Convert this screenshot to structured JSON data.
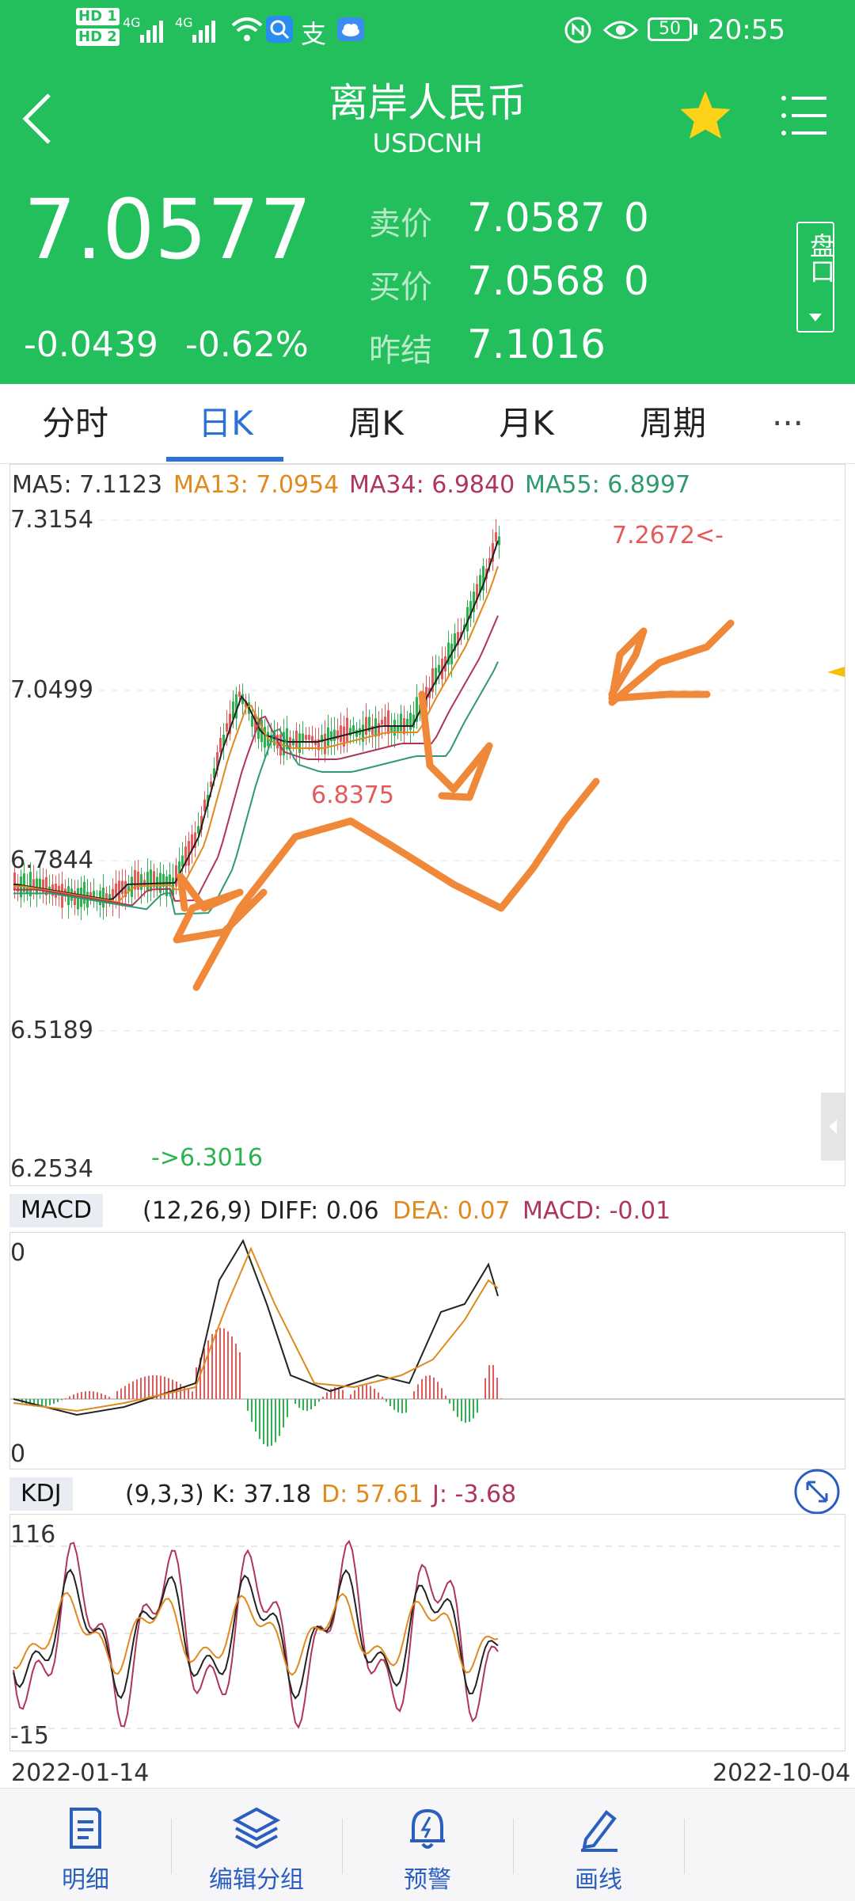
{
  "status": {
    "hd1": "HD 1",
    "hd2": "HD 2",
    "net1": "4G",
    "net2": "4G",
    "battery": "50",
    "time": "20:55"
  },
  "nav": {
    "title": "离岸人民币",
    "subtitle": "USDCNH"
  },
  "quote": {
    "price": "7.0577",
    "change": "-0.0439",
    "change_pct": "-0.62%",
    "sell_label": "卖价",
    "sell_price": "7.0587",
    "sell_vol": "0",
    "buy_label": "买价",
    "buy_price": "7.0568",
    "buy_vol": "0",
    "prev_label": "昨结",
    "prev_close": "7.1016",
    "side_tab": "盘口"
  },
  "tabs": [
    "分时",
    "日K",
    "周K",
    "月K",
    "周期",
    "···"
  ],
  "ma": {
    "ma5": "MA5: 7.1123",
    "ma13": "MA13: 7.0954",
    "ma34": "MA34: 6.9840",
    "ma55": "MA55: 6.8997"
  },
  "main_axis": [
    "7.3154",
    "7.0499",
    "6.7844",
    "6.5189",
    "6.2534"
  ],
  "annotations": {
    "high": "7.2672<-",
    "mid": "6.8375",
    "low": "->6.3016"
  },
  "macd": {
    "label": "MACD",
    "params": "(12,26,9)",
    "diff": "DIFF: 0.06",
    "dea": "DEA: 0.07",
    "macd": "MACD: -0.01",
    "axis_top": "0",
    "axis_bottom": "0"
  },
  "kdj": {
    "label": "KDJ",
    "params": "(9,3,3)",
    "k": "K: 37.18",
    "d": "D: 57.61",
    "j": "J: -3.68",
    "axis_top": "116",
    "axis_bottom": "-15"
  },
  "dates": {
    "start": "2022-01-14",
    "end": "2022-10-04"
  },
  "bottom_nav": [
    "明细",
    "编辑分组",
    "预警",
    "画线"
  ],
  "colors": {
    "brand_green": "#22bf5c",
    "up_red": "#e45a5a",
    "down_green": "#2bb34f",
    "ma5": "#222222",
    "ma13": "#e08a1e",
    "ma34": "#b0355a",
    "ma55": "#2e9b6e",
    "accent_blue": "#2a72d6",
    "drawing": "#f0883a"
  }
}
